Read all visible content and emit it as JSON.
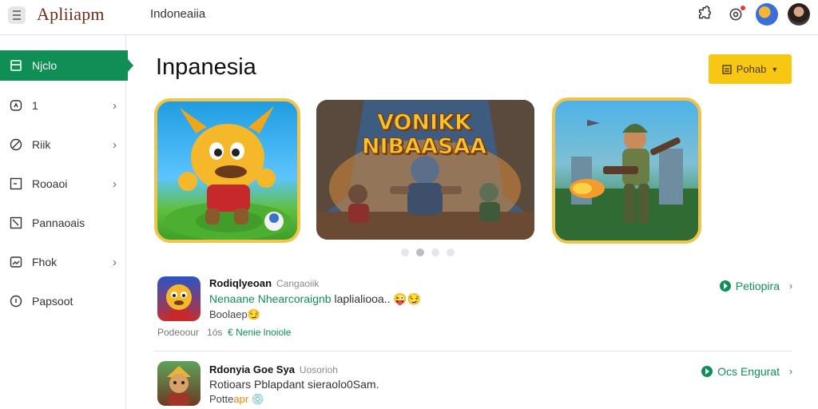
{
  "header": {
    "brand": "Apliiapm",
    "region": "Indoneaiia",
    "icons": [
      "menu-icon",
      "puzzle-icon",
      "notification-icon",
      "avatar",
      "avatar"
    ]
  },
  "sidebar": {
    "items": [
      {
        "label": "Njclo",
        "icon": "page-icon",
        "active": true,
        "chevron": false
      },
      {
        "label": "1",
        "icon": "compass-icon",
        "active": false,
        "chevron": true
      },
      {
        "label": "Riik",
        "icon": "slash-circle-icon",
        "active": false,
        "chevron": true
      },
      {
        "label": "Rooaoi",
        "icon": "square-dash-icon",
        "active": false,
        "chevron": true
      },
      {
        "label": "Pannaoais",
        "icon": "corner-icon",
        "active": false,
        "chevron": false
      },
      {
        "label": "Fhok",
        "icon": "image-icon",
        "active": false,
        "chevron": true
      },
      {
        "label": "Papsoot",
        "icon": "info-circle-icon",
        "active": false,
        "chevron": false
      }
    ]
  },
  "main": {
    "title": "Inpanesia",
    "filter_label": "Pohab",
    "carousel_banner_text": "VONIKK NIBAASAA",
    "carousel_dots": 4,
    "carousel_active_dot": 1
  },
  "apps": [
    {
      "title": "Rodiqlyeoan",
      "category": "Cangaoiik",
      "desc_green": "Nenaane Nhearcoraignb",
      "desc_rest": " laplialiooa.. 😜😏",
      "extra": "Boolaep😏",
      "meta_prefix": "Podeoour",
      "meta_num": "1ós",
      "meta_green": "€ Nenie lnoiole",
      "action": "Petiopira",
      "action_arrow": "›"
    },
    {
      "title": "Rdonyia Goe Sya",
      "category": "Uosorioh",
      "desc": "Rotioars Pblapdant sieraolo0Sam.",
      "extra_a": "Potte",
      "extra_b": "apr",
      "extra_emoji": "💿",
      "action": "Ocs Engurat",
      "action_arrow": "›"
    }
  ],
  "colors": {
    "accent_green": "#0f8f56",
    "filter_yellow": "#f6c814",
    "brand_brown": "#6d2d1b"
  }
}
